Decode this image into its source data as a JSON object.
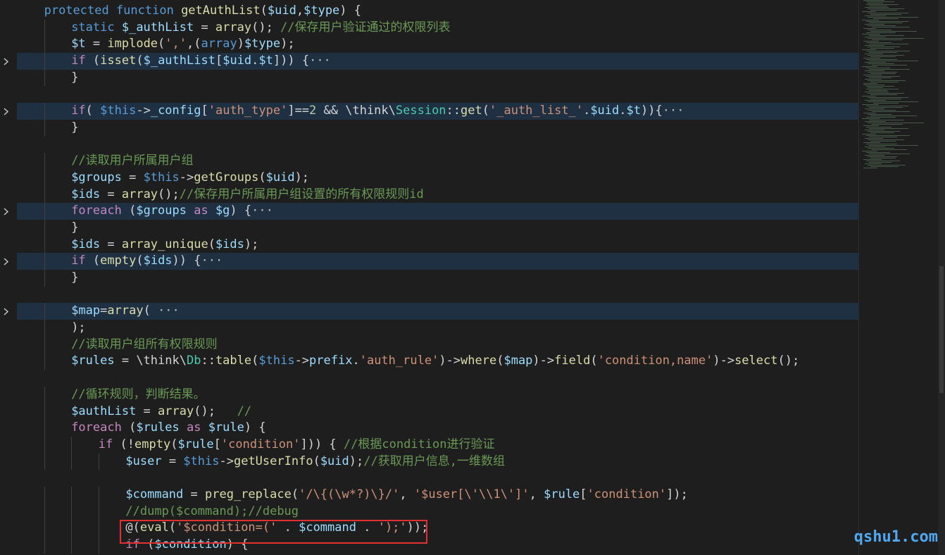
{
  "colors": {
    "keyword": "#569cd6",
    "control": "#c586c0",
    "function": "#dcdcaa",
    "variable": "#9cdcfe",
    "string": "#ce9178",
    "comment": "#6a9955",
    "number": "#b5cea8",
    "class": "#4ec9b0",
    "plain": "#d4d4d4"
  },
  "watermark": "qshu1.com",
  "lines": [
    {
      "indent": 1,
      "folded": false,
      "tokens": [
        [
          "protected function ",
          "keyword"
        ],
        [
          "getAuthList",
          "function"
        ],
        [
          "(",
          "plain"
        ],
        [
          "$uid",
          "variable"
        ],
        [
          ",",
          "plain"
        ],
        [
          "$type",
          "variable"
        ],
        [
          ") {",
          "plain"
        ]
      ]
    },
    {
      "indent": 2,
      "folded": false,
      "tokens": [
        [
          "static ",
          "keyword"
        ],
        [
          "$_authList",
          "variable"
        ],
        [
          " = ",
          "plain"
        ],
        [
          "array",
          "function"
        ],
        [
          "(); ",
          "plain"
        ],
        [
          "//保存用户验证通过的权限列表",
          "comment"
        ]
      ]
    },
    {
      "indent": 2,
      "folded": false,
      "tokens": [
        [
          "$t",
          "variable"
        ],
        [
          " = ",
          "plain"
        ],
        [
          "implode",
          "function"
        ],
        [
          "(",
          "plain"
        ],
        [
          "','",
          "string"
        ],
        [
          ",(",
          "plain"
        ],
        [
          "array",
          "keyword"
        ],
        [
          ")",
          "plain"
        ],
        [
          "$type",
          "variable"
        ],
        [
          ");",
          "plain"
        ]
      ]
    },
    {
      "indent": 2,
      "folded": true,
      "tokens": [
        [
          "if",
          "control"
        ],
        [
          " (",
          "plain"
        ],
        [
          "isset",
          "function"
        ],
        [
          "(",
          "plain"
        ],
        [
          "$_authList",
          "variable"
        ],
        [
          "[",
          "plain"
        ],
        [
          "$uid",
          "variable"
        ],
        [
          ".",
          "plain"
        ],
        [
          "$t",
          "variable"
        ],
        [
          "])) {",
          "plain"
        ],
        [
          "···",
          "ellipsis"
        ]
      ]
    },
    {
      "indent": 2,
      "folded": false,
      "tokens": [
        [
          "}",
          "plain"
        ]
      ]
    },
    {
      "indent": 0,
      "folded": false,
      "tokens": []
    },
    {
      "indent": 2,
      "folded": true,
      "tokens": [
        [
          "if",
          "control"
        ],
        [
          "( ",
          "plain"
        ],
        [
          "$this",
          "keyword"
        ],
        [
          "->",
          "plain"
        ],
        [
          "_config",
          "variable"
        ],
        [
          "[",
          "plain"
        ],
        [
          "'auth_type'",
          "string"
        ],
        [
          "]==",
          "plain"
        ],
        [
          "2",
          "number"
        ],
        [
          " && \\think\\",
          "plain"
        ],
        [
          "Session",
          "class"
        ],
        [
          "::",
          "plain"
        ],
        [
          "get",
          "function"
        ],
        [
          "(",
          "plain"
        ],
        [
          "'_auth_list_'",
          "string"
        ],
        [
          ".",
          "plain"
        ],
        [
          "$uid",
          "variable"
        ],
        [
          ".",
          "plain"
        ],
        [
          "$t",
          "variable"
        ],
        [
          ")){",
          "plain"
        ],
        [
          "···",
          "ellipsis"
        ]
      ]
    },
    {
      "indent": 2,
      "folded": false,
      "tokens": [
        [
          "}",
          "plain"
        ]
      ]
    },
    {
      "indent": 0,
      "folded": false,
      "tokens": []
    },
    {
      "indent": 2,
      "folded": false,
      "tokens": [
        [
          "//读取用户所属用户组",
          "comment"
        ]
      ]
    },
    {
      "indent": 2,
      "folded": false,
      "tokens": [
        [
          "$groups",
          "variable"
        ],
        [
          " = ",
          "plain"
        ],
        [
          "$this",
          "keyword"
        ],
        [
          "->",
          "plain"
        ],
        [
          "getGroups",
          "function"
        ],
        [
          "(",
          "plain"
        ],
        [
          "$uid",
          "variable"
        ],
        [
          ");",
          "plain"
        ]
      ]
    },
    {
      "indent": 2,
      "folded": false,
      "tokens": [
        [
          "$ids",
          "variable"
        ],
        [
          " = ",
          "plain"
        ],
        [
          "array",
          "function"
        ],
        [
          "();",
          "plain"
        ],
        [
          "//保存用户所属用户组设置的所有权限规则id",
          "comment"
        ]
      ]
    },
    {
      "indent": 2,
      "folded": true,
      "tokens": [
        [
          "foreach",
          "control"
        ],
        [
          " (",
          "plain"
        ],
        [
          "$groups",
          "variable"
        ],
        [
          " as ",
          "control"
        ],
        [
          "$g",
          "variable"
        ],
        [
          ") {",
          "plain"
        ],
        [
          "···",
          "ellipsis"
        ]
      ]
    },
    {
      "indent": 2,
      "folded": false,
      "tokens": [
        [
          "}",
          "plain"
        ]
      ]
    },
    {
      "indent": 2,
      "folded": false,
      "tokens": [
        [
          "$ids",
          "variable"
        ],
        [
          " = ",
          "plain"
        ],
        [
          "array_unique",
          "function"
        ],
        [
          "(",
          "plain"
        ],
        [
          "$ids",
          "variable"
        ],
        [
          ");",
          "plain"
        ]
      ]
    },
    {
      "indent": 2,
      "folded": true,
      "tokens": [
        [
          "if",
          "control"
        ],
        [
          " (",
          "plain"
        ],
        [
          "empty",
          "function"
        ],
        [
          "(",
          "plain"
        ],
        [
          "$ids",
          "variable"
        ],
        [
          ")) {",
          "plain"
        ],
        [
          "···",
          "ellipsis"
        ]
      ]
    },
    {
      "indent": 2,
      "folded": false,
      "tokens": [
        [
          "}",
          "plain"
        ]
      ]
    },
    {
      "indent": 0,
      "folded": false,
      "tokens": []
    },
    {
      "indent": 2,
      "folded": true,
      "tokens": [
        [
          "$map",
          "variable"
        ],
        [
          "=",
          "plain"
        ],
        [
          "array",
          "function"
        ],
        [
          "( ",
          "plain"
        ],
        [
          "···",
          "ellipsis"
        ]
      ]
    },
    {
      "indent": 2,
      "folded": false,
      "tokens": [
        [
          ");",
          "plain"
        ]
      ]
    },
    {
      "indent": 2,
      "folded": false,
      "tokens": [
        [
          "//读取用户组所有权限规则",
          "comment"
        ]
      ]
    },
    {
      "indent": 2,
      "folded": false,
      "tokens": [
        [
          "$rules",
          "variable"
        ],
        [
          " = \\think\\",
          "plain"
        ],
        [
          "Db",
          "class"
        ],
        [
          "::",
          "plain"
        ],
        [
          "table",
          "function"
        ],
        [
          "(",
          "plain"
        ],
        [
          "$this",
          "keyword"
        ],
        [
          "->",
          "plain"
        ],
        [
          "prefix",
          "variable"
        ],
        [
          ".",
          "plain"
        ],
        [
          "'auth_rule'",
          "string"
        ],
        [
          ")->",
          "plain"
        ],
        [
          "where",
          "function"
        ],
        [
          "(",
          "plain"
        ],
        [
          "$map",
          "variable"
        ],
        [
          ")->",
          "plain"
        ],
        [
          "field",
          "function"
        ],
        [
          "(",
          "plain"
        ],
        [
          "'condition,name'",
          "string"
        ],
        [
          ")->",
          "plain"
        ],
        [
          "select",
          "function"
        ],
        [
          "();",
          "plain"
        ]
      ]
    },
    {
      "indent": 0,
      "folded": false,
      "tokens": []
    },
    {
      "indent": 2,
      "folded": false,
      "tokens": [
        [
          "//循环规则，判断结果。",
          "comment"
        ]
      ]
    },
    {
      "indent": 2,
      "folded": false,
      "tokens": [
        [
          "$authList",
          "variable"
        ],
        [
          " = ",
          "plain"
        ],
        [
          "array",
          "function"
        ],
        [
          "();   ",
          "plain"
        ],
        [
          "//",
          "comment"
        ]
      ]
    },
    {
      "indent": 2,
      "folded": false,
      "tokens": [
        [
          "foreach",
          "control"
        ],
        [
          " (",
          "plain"
        ],
        [
          "$rules",
          "variable"
        ],
        [
          " as ",
          "control"
        ],
        [
          "$rule",
          "variable"
        ],
        [
          ") {",
          "plain"
        ]
      ]
    },
    {
      "indent": 3,
      "folded": false,
      "tokens": [
        [
          "if",
          "control"
        ],
        [
          " (!",
          "plain"
        ],
        [
          "empty",
          "function"
        ],
        [
          "(",
          "plain"
        ],
        [
          "$rule",
          "variable"
        ],
        [
          "[",
          "plain"
        ],
        [
          "'condition'",
          "string"
        ],
        [
          "])) { ",
          "plain"
        ],
        [
          "//根据condition进行验证",
          "comment"
        ]
      ]
    },
    {
      "indent": 4,
      "folded": false,
      "tokens": [
        [
          "$user",
          "variable"
        ],
        [
          " = ",
          "plain"
        ],
        [
          "$this",
          "keyword"
        ],
        [
          "->",
          "plain"
        ],
        [
          "getUserInfo",
          "function"
        ],
        [
          "(",
          "plain"
        ],
        [
          "$uid",
          "variable"
        ],
        [
          ");",
          "plain"
        ],
        [
          "//获取用户信息,一维数组",
          "comment"
        ]
      ]
    },
    {
      "indent": 0,
      "folded": false,
      "tokens": []
    },
    {
      "indent": 4,
      "folded": false,
      "tokens": [
        [
          "$command",
          "variable"
        ],
        [
          " = ",
          "plain"
        ],
        [
          "preg_replace",
          "function"
        ],
        [
          "(",
          "plain"
        ],
        [
          "'/\\{(\\w*?)\\}/'",
          "string"
        ],
        [
          ", ",
          "plain"
        ],
        [
          "'$user[\\'\\\\1\\']'",
          "string"
        ],
        [
          ", ",
          "plain"
        ],
        [
          "$rule",
          "variable"
        ],
        [
          "[",
          "plain"
        ],
        [
          "'condition'",
          "string"
        ],
        [
          "]);",
          "plain"
        ]
      ]
    },
    {
      "indent": 4,
      "folded": false,
      "tokens": [
        [
          "//dump($command);//debug",
          "comment"
        ]
      ]
    },
    {
      "indent": 4,
      "folded": false,
      "tokens": [
        [
          "@(",
          "plain"
        ],
        [
          "eval",
          "function"
        ],
        [
          "(",
          "plain"
        ],
        [
          "'$condition=('",
          "string"
        ],
        [
          " . ",
          "plain"
        ],
        [
          "$command",
          "variable"
        ],
        [
          " . ",
          "plain"
        ],
        [
          "');'",
          "string"
        ],
        [
          "));",
          "plain"
        ]
      ]
    },
    {
      "indent": 4,
      "folded": false,
      "tokens": [
        [
          "if",
          "control"
        ],
        [
          " (",
          "plain"
        ],
        [
          "$condition",
          "variable"
        ],
        [
          ") {",
          "plain"
        ]
      ]
    }
  ]
}
